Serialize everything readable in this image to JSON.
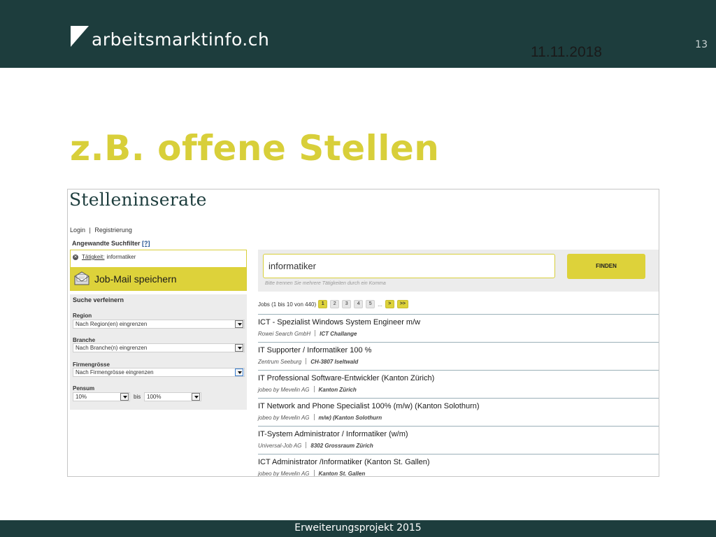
{
  "header": {
    "logo_text": "arbeitsmarktinfo.ch",
    "date": "11.11.2018",
    "page_number": "13",
    "colors": {
      "band": "#1d3d3d",
      "accent": "#d8cf3a"
    }
  },
  "slide": {
    "title": "z.B. offene Stellen"
  },
  "screenshot": {
    "title": "Stelleninserate",
    "auth": {
      "login": "Login",
      "separator": "|",
      "register": "Registrierung"
    },
    "applied_filters": {
      "heading": "Angewandte Suchfilter",
      "help": "[?]",
      "filter_label": "Tätigkeit:",
      "filter_value": "informatiker",
      "jobmail_button": "Job-Mail speichern"
    },
    "refine": {
      "heading": "Suche verfeinern",
      "region_label": "Region",
      "region_value": "Nach Region(en) eingrenzen",
      "branche_label": "Branche",
      "branche_value": "Nach Branche(n) eingrenzen",
      "firm_label": "Firmengrösse",
      "firm_value": "Nach Firmengrösse eingrenzen",
      "pensum_label": "Pensum",
      "pensum_from": "10%",
      "pensum_bis": "bis",
      "pensum_to": "100%"
    },
    "search": {
      "value": "informatiker",
      "button": "FINDEN",
      "hint": "Bitte trennen Sie mehrere Tätigkeiten durch ein Komma"
    },
    "pager": {
      "count": "Jobs (1 bis 10 von 440)",
      "pages": [
        "1",
        "2",
        "3",
        "4",
        "5"
      ],
      "ellipsis": "...",
      "next": ">",
      "last": ">>"
    },
    "jobs": [
      {
        "title": "ICT - Spezialist Windows System Engineer m/w",
        "company": "Rowei Search GmbH",
        "location": "ICT Challange"
      },
      {
        "title": "IT Supporter / Informatiker 100 %",
        "company": "Zentrum Seeburg",
        "location": "CH-3807 Iseltwald"
      },
      {
        "title": "IT Professional Software-Entwickler (Kanton Zürich)",
        "company": "jobeo by Mevelin AG",
        "location": "Kanton Zürich"
      },
      {
        "title": "IT Network and Phone Specialist 100% (m/w) (Kanton Solothurn)",
        "company": "jobeo by Mevelin AG",
        "location": "m/w) (Kanton Solothurn"
      },
      {
        "title": "IT-System Administrator / Informatiker (w/m)",
        "company": "Universal-Job AG",
        "location": "8302 Grossraum Zürich"
      },
      {
        "title": "ICT Administrator /Informatiker (Kanton St. Gallen)",
        "company": "jobeo by Mevelin AG",
        "location": "Kanton St. Gallen"
      }
    ]
  },
  "footer": {
    "text": "Erweiterungsprojekt 2015"
  }
}
